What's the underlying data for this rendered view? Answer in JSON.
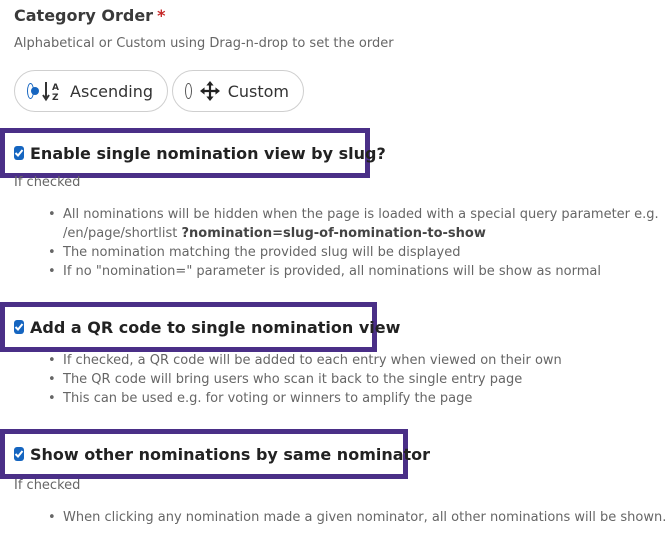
{
  "category_order": {
    "title": "Category Order",
    "required_mark": "*",
    "description": "Alphabetical or Custom using Drag-n-drop to set the order",
    "options": [
      {
        "label": "Ascending",
        "icon": "sort-alpha-down-icon",
        "selected": true
      },
      {
        "label": "Custom",
        "icon": "move-arrows-icon",
        "selected": false
      }
    ]
  },
  "single_view": {
    "label": "Enable single nomination view by slug?",
    "checked": true,
    "helper": "If checked",
    "bullets": [
      {
        "text": "All nominations will be hidden when the page is loaded with a special query parameter e.g.",
        "line2_prefix": "/en/page/shortlist ",
        "line2_bold": "?nomination=slug-of-nomination-to-show"
      },
      {
        "text": "The nomination matching the provided slug will be displayed"
      },
      {
        "text": "If no \"nomination=\" parameter is provided, all nominations will be show as normal"
      }
    ]
  },
  "qr_code": {
    "label": "Add a QR code to single nomination view",
    "checked": true,
    "bullets": [
      "If checked, a QR code will be added to each entry when viewed on their own",
      "The QR code will bring users who scan it back to the single entry page",
      "This can be used e.g. for voting or winners to amplify the page"
    ]
  },
  "other_nominations": {
    "label": "Show other nominations by same nominator",
    "checked": true,
    "helper": "If checked",
    "bullets": [
      "When clicking any nomination made a given nominator, all other nominations will be shown."
    ]
  },
  "colors": {
    "accent": "#1565c0",
    "highlight_border": "#4a2f87",
    "required": "#c62828"
  }
}
